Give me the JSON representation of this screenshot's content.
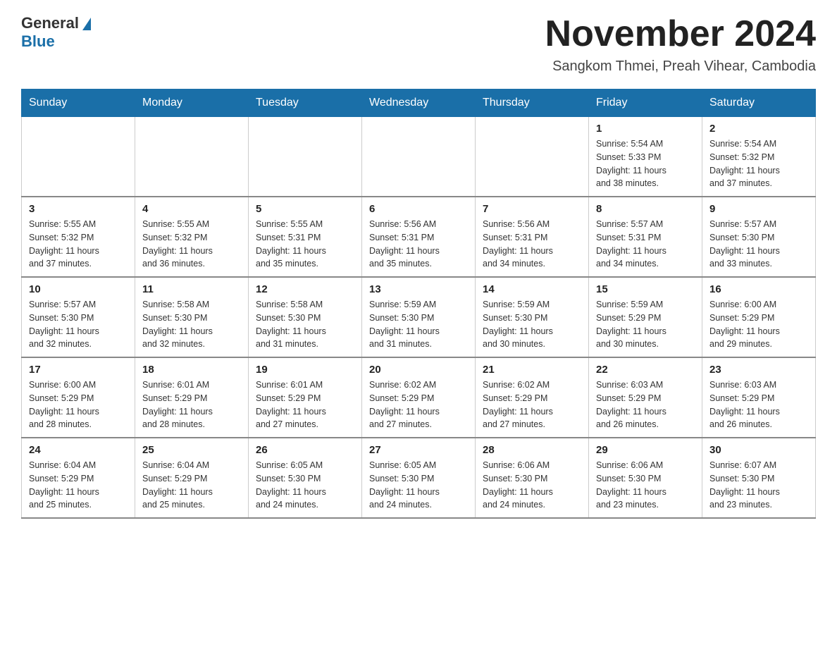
{
  "logo": {
    "general": "General",
    "blue": "Blue"
  },
  "header": {
    "month": "November 2024",
    "location": "Sangkom Thmei, Preah Vihear, Cambodia"
  },
  "weekdays": [
    "Sunday",
    "Monday",
    "Tuesday",
    "Wednesday",
    "Thursday",
    "Friday",
    "Saturday"
  ],
  "weeks": [
    [
      {
        "day": "",
        "info": ""
      },
      {
        "day": "",
        "info": ""
      },
      {
        "day": "",
        "info": ""
      },
      {
        "day": "",
        "info": ""
      },
      {
        "day": "",
        "info": ""
      },
      {
        "day": "1",
        "info": "Sunrise: 5:54 AM\nSunset: 5:33 PM\nDaylight: 11 hours\nand 38 minutes."
      },
      {
        "day": "2",
        "info": "Sunrise: 5:54 AM\nSunset: 5:32 PM\nDaylight: 11 hours\nand 37 minutes."
      }
    ],
    [
      {
        "day": "3",
        "info": "Sunrise: 5:55 AM\nSunset: 5:32 PM\nDaylight: 11 hours\nand 37 minutes."
      },
      {
        "day": "4",
        "info": "Sunrise: 5:55 AM\nSunset: 5:32 PM\nDaylight: 11 hours\nand 36 minutes."
      },
      {
        "day": "5",
        "info": "Sunrise: 5:55 AM\nSunset: 5:31 PM\nDaylight: 11 hours\nand 35 minutes."
      },
      {
        "day": "6",
        "info": "Sunrise: 5:56 AM\nSunset: 5:31 PM\nDaylight: 11 hours\nand 35 minutes."
      },
      {
        "day": "7",
        "info": "Sunrise: 5:56 AM\nSunset: 5:31 PM\nDaylight: 11 hours\nand 34 minutes."
      },
      {
        "day": "8",
        "info": "Sunrise: 5:57 AM\nSunset: 5:31 PM\nDaylight: 11 hours\nand 34 minutes."
      },
      {
        "day": "9",
        "info": "Sunrise: 5:57 AM\nSunset: 5:30 PM\nDaylight: 11 hours\nand 33 minutes."
      }
    ],
    [
      {
        "day": "10",
        "info": "Sunrise: 5:57 AM\nSunset: 5:30 PM\nDaylight: 11 hours\nand 32 minutes."
      },
      {
        "day": "11",
        "info": "Sunrise: 5:58 AM\nSunset: 5:30 PM\nDaylight: 11 hours\nand 32 minutes."
      },
      {
        "day": "12",
        "info": "Sunrise: 5:58 AM\nSunset: 5:30 PM\nDaylight: 11 hours\nand 31 minutes."
      },
      {
        "day": "13",
        "info": "Sunrise: 5:59 AM\nSunset: 5:30 PM\nDaylight: 11 hours\nand 31 minutes."
      },
      {
        "day": "14",
        "info": "Sunrise: 5:59 AM\nSunset: 5:30 PM\nDaylight: 11 hours\nand 30 minutes."
      },
      {
        "day": "15",
        "info": "Sunrise: 5:59 AM\nSunset: 5:29 PM\nDaylight: 11 hours\nand 30 minutes."
      },
      {
        "day": "16",
        "info": "Sunrise: 6:00 AM\nSunset: 5:29 PM\nDaylight: 11 hours\nand 29 minutes."
      }
    ],
    [
      {
        "day": "17",
        "info": "Sunrise: 6:00 AM\nSunset: 5:29 PM\nDaylight: 11 hours\nand 28 minutes."
      },
      {
        "day": "18",
        "info": "Sunrise: 6:01 AM\nSunset: 5:29 PM\nDaylight: 11 hours\nand 28 minutes."
      },
      {
        "day": "19",
        "info": "Sunrise: 6:01 AM\nSunset: 5:29 PM\nDaylight: 11 hours\nand 27 minutes."
      },
      {
        "day": "20",
        "info": "Sunrise: 6:02 AM\nSunset: 5:29 PM\nDaylight: 11 hours\nand 27 minutes."
      },
      {
        "day": "21",
        "info": "Sunrise: 6:02 AM\nSunset: 5:29 PM\nDaylight: 11 hours\nand 27 minutes."
      },
      {
        "day": "22",
        "info": "Sunrise: 6:03 AM\nSunset: 5:29 PM\nDaylight: 11 hours\nand 26 minutes."
      },
      {
        "day": "23",
        "info": "Sunrise: 6:03 AM\nSunset: 5:29 PM\nDaylight: 11 hours\nand 26 minutes."
      }
    ],
    [
      {
        "day": "24",
        "info": "Sunrise: 6:04 AM\nSunset: 5:29 PM\nDaylight: 11 hours\nand 25 minutes."
      },
      {
        "day": "25",
        "info": "Sunrise: 6:04 AM\nSunset: 5:29 PM\nDaylight: 11 hours\nand 25 minutes."
      },
      {
        "day": "26",
        "info": "Sunrise: 6:05 AM\nSunset: 5:30 PM\nDaylight: 11 hours\nand 24 minutes."
      },
      {
        "day": "27",
        "info": "Sunrise: 6:05 AM\nSunset: 5:30 PM\nDaylight: 11 hours\nand 24 minutes."
      },
      {
        "day": "28",
        "info": "Sunrise: 6:06 AM\nSunset: 5:30 PM\nDaylight: 11 hours\nand 24 minutes."
      },
      {
        "day": "29",
        "info": "Sunrise: 6:06 AM\nSunset: 5:30 PM\nDaylight: 11 hours\nand 23 minutes."
      },
      {
        "day": "30",
        "info": "Sunrise: 6:07 AM\nSunset: 5:30 PM\nDaylight: 11 hours\nand 23 minutes."
      }
    ]
  ]
}
